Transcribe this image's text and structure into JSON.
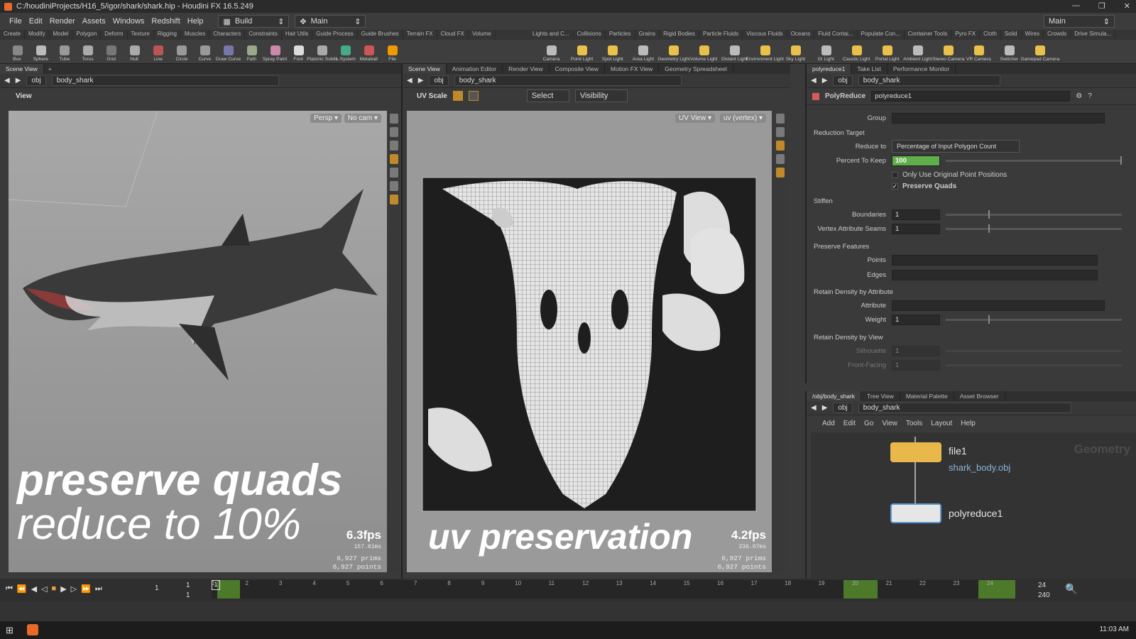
{
  "window": {
    "title": "C:/houdiniProjects/H16_5/igor/shark/shark.hip - Houdini FX 16.5.249",
    "controls": [
      "—",
      "❐",
      "✕"
    ]
  },
  "menu": {
    "items": [
      "File",
      "Edit",
      "Render",
      "Assets",
      "Windows",
      "Redshift",
      "Help"
    ],
    "desktop": "Build",
    "desktop_right": "Main",
    "desktop_label": "Main"
  },
  "shelf_tabs_left": [
    "Create",
    "Modify",
    "Model",
    "Polygon",
    "Deform",
    "Texture",
    "Rigging",
    "Muscles",
    "Characters",
    "Constraints",
    "Hair Utils",
    "Guide Process",
    "Guide Brushes",
    "Terrain FX",
    "Cloud FX",
    "Volume"
  ],
  "shelf_tabs_right": [
    "Lights and C...",
    "Collisions",
    "Particles",
    "Grains",
    "Rigid Bodies",
    "Particle Fluids",
    "Viscous Fluids",
    "Oceans",
    "Fluid Contai...",
    "Populate Con...",
    "Container Tools",
    "Pyro FX",
    "Cloth",
    "Solid",
    "Wires",
    "Crowds",
    "Drive Simula..."
  ],
  "shelf_tools_left": [
    {
      "label": "Box",
      "icon": "box-icon"
    },
    {
      "label": "Sphere",
      "icon": "sphere-icon"
    },
    {
      "label": "Tube",
      "icon": "tube-icon"
    },
    {
      "label": "Torus",
      "icon": "torus-icon"
    },
    {
      "label": "Grid",
      "icon": "grid-icon"
    },
    {
      "label": "Null",
      "icon": "null-icon"
    },
    {
      "label": "Line",
      "icon": "line-icon"
    },
    {
      "label": "Circle",
      "icon": "circle-icon"
    },
    {
      "label": "Curve",
      "icon": "curve-icon"
    },
    {
      "label": "Draw Curve",
      "icon": "draw-curve-icon"
    },
    {
      "label": "Path",
      "icon": "path-icon"
    },
    {
      "label": "Spray Paint",
      "icon": "spray-paint-icon"
    },
    {
      "label": "Font",
      "icon": "font-icon"
    },
    {
      "label": "Platonic Solids",
      "icon": "platonic-icon"
    },
    {
      "label": "L-System",
      "icon": "lsystem-icon"
    },
    {
      "label": "Metaball",
      "icon": "metaball-icon"
    },
    {
      "label": "File",
      "icon": "file-icon"
    }
  ],
  "shelf_tools_right": [
    {
      "label": "Camera"
    },
    {
      "label": "Point Light"
    },
    {
      "label": "Spot Light"
    },
    {
      "label": "Area Light"
    },
    {
      "label": "Geometry Light"
    },
    {
      "label": "Volume Light"
    },
    {
      "label": "Distant Light"
    },
    {
      "label": "Environment Light"
    },
    {
      "label": "Sky Light"
    },
    {
      "label": "GI Light"
    },
    {
      "label": "Caustic Light"
    },
    {
      "label": "Portal Light"
    },
    {
      "label": "Ambient Light"
    },
    {
      "label": "Stereo Camera"
    },
    {
      "label": "VR Camera"
    },
    {
      "label": "Switcher"
    },
    {
      "label": "Gamepad Camera"
    }
  ],
  "left_pane": {
    "tab": "Scene View",
    "obj": "obj",
    "node": "body_shark",
    "view_label": "View",
    "persp": "Persp ▾",
    "cam": "No cam ▾",
    "overlay_line1": "preserve quads",
    "overlay_line2": "reduce to 10%",
    "fps": "6.3fps",
    "ms": "157.81ms",
    "prims": "6,927  prims",
    "points": "6,927  points"
  },
  "mid_pane": {
    "tabs": [
      "Scene View",
      "Animation Editor",
      "Render View",
      "Composite View",
      "Motion FX View",
      "Geometry Spreadsheet"
    ],
    "obj": "obj",
    "node": "body_shark",
    "tool": "UV Scale",
    "select": "Select",
    "visibility": "Visibility",
    "uvview": "UV View ▾",
    "uvvertex": "uv (vertex) ▾",
    "overlay": "uv preservation",
    "fps": "4.2fps",
    "ms": "236.07ms",
    "prims": "6,927  prims",
    "points": "6,927  points"
  },
  "params": {
    "tabs": [
      "polyreduce1",
      "Take List",
      "Performance Monitor"
    ],
    "obj": "obj",
    "node": "body_shark",
    "type": "PolyReduce",
    "name": "polyreduce1",
    "group_label": "Group",
    "reduction_target": "Reduction Target",
    "reduce_to_label": "Reduce to",
    "reduce_to_value": "Percentage of Input Polygon Count",
    "percent_label": "Percent To Keep",
    "percent_value": "100",
    "percent_fraction": 1.0,
    "only_original": "Only Use Original Point Positions",
    "preserve_quads": "Preserve Quads",
    "stiffen": "Stiffen",
    "boundaries_label": "Boundaries",
    "boundaries": "1",
    "vas_label": "Vertex Attribute Seams",
    "vas": "1",
    "preserve_features": "Preserve Features",
    "points_label": "Points",
    "edges_label": "Edges",
    "retain_attr": "Retain Density by Attribute",
    "attribute_label": "Attribute",
    "weight_label": "Weight",
    "weight": "1",
    "retain_view": "Retain Density by View",
    "silhouette_label": "Silhouette",
    "silhouette": "1",
    "front_label": "Front-Facing",
    "front": "1"
  },
  "network": {
    "tabs": [
      "/obj/body_shark",
      "Tree View",
      "Material Palette",
      "Asset Browser"
    ],
    "obj": "obj",
    "node": "body_shark",
    "menu": [
      "Add",
      "Edit",
      "Go",
      "View",
      "Tools",
      "Layout",
      "Help"
    ],
    "watermark": "Geometry",
    "nodes": [
      {
        "name": "file1",
        "sub": "shark_body.obj"
      },
      {
        "name": "polyreduce1",
        "sub": ""
      }
    ]
  },
  "timeline": {
    "ticks": [
      "1",
      "2",
      "3",
      "4",
      "5",
      "6",
      "7",
      "8",
      "9",
      "10",
      "11",
      "12",
      "13",
      "14",
      "15",
      "16",
      "17",
      "18",
      "19",
      "20",
      "21",
      "22",
      "23",
      "24"
    ],
    "start": "1",
    "start2": "1",
    "frame": "1",
    "end": "24",
    "end2": "240"
  },
  "taskbar": {
    "time": "11:03 AM"
  }
}
